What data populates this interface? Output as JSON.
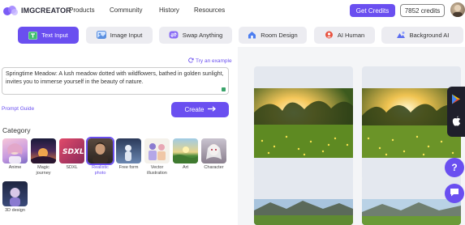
{
  "header": {
    "logo_text": "IMGCREATOR",
    "nav": [
      "Products",
      "Community",
      "History",
      "Resources"
    ],
    "get_credits_label": "Get Credits",
    "credits_count": "7852 credits"
  },
  "tabs": [
    {
      "label": "Text Input",
      "icon": "text-input-icon",
      "active": true
    },
    {
      "label": "Image Input",
      "icon": "image-input-icon",
      "active": false
    },
    {
      "label": "Swap Anything",
      "icon": "swap-icon",
      "active": false
    },
    {
      "label": "Room Design",
      "icon": "room-icon",
      "active": false
    },
    {
      "label": "AI Human",
      "icon": "ai-human-icon",
      "active": false
    },
    {
      "label": "Background AI",
      "icon": "background-icon",
      "active": false
    }
  ],
  "prompt": {
    "try_example": "Try an example",
    "text": "Springtime Meadow: A lush meadow dotted with wildflowers, bathed in golden sunlight, invites you to immerse yourself in the beauty of nature.",
    "guide_label": "Prompt Guide",
    "create_label": "Create"
  },
  "category": {
    "label": "Category",
    "items": [
      {
        "label": "Anime",
        "selected": false
      },
      {
        "label": "Magic journey",
        "selected": false
      },
      {
        "label": "SDXL",
        "selected": false
      },
      {
        "label": "Realistic photo",
        "selected": true
      },
      {
        "label": "Free form",
        "selected": false
      },
      {
        "label": "Vector illustration",
        "selected": false
      },
      {
        "label": "Art",
        "selected": false
      },
      {
        "label": "Character",
        "selected": false
      },
      {
        "label": "3D design",
        "selected": false
      }
    ]
  },
  "colors": {
    "accent": "#6a4ff0",
    "tab_bg": "#ececf1"
  }
}
